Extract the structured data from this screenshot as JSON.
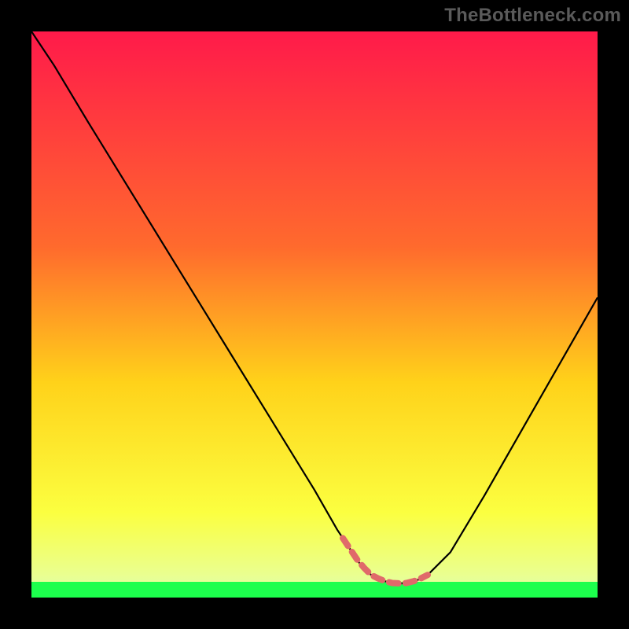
{
  "watermark": "TheBottleneck.com",
  "gradient": {
    "top": "#ff1a4a",
    "mid1": "#ff6a2d",
    "mid2": "#ffd21a",
    "mid3": "#fbff40",
    "bottom_band": "#1cff4d"
  },
  "flat_stroke": "#e06a6a",
  "chart_data": {
    "type": "line",
    "title": "",
    "xlabel": "",
    "ylabel": "",
    "xlim": [
      0,
      100
    ],
    "ylim": [
      0,
      100
    ],
    "series": [
      {
        "name": "curve",
        "x": [
          0,
          4,
          10,
          18,
          26,
          34,
          42,
          50,
          54,
          56,
          58,
          60,
          62,
          64,
          66,
          68,
          70,
          74,
          80,
          88,
          96,
          100
        ],
        "y": [
          100,
          94,
          84,
          71,
          58,
          45,
          32,
          19,
          12,
          9,
          6,
          4,
          3,
          2.5,
          2.5,
          3,
          4,
          8,
          18,
          32,
          46,
          53
        ]
      }
    ],
    "flat_region_x": [
      55,
      70
    ],
    "green_band_y": 2.5
  }
}
